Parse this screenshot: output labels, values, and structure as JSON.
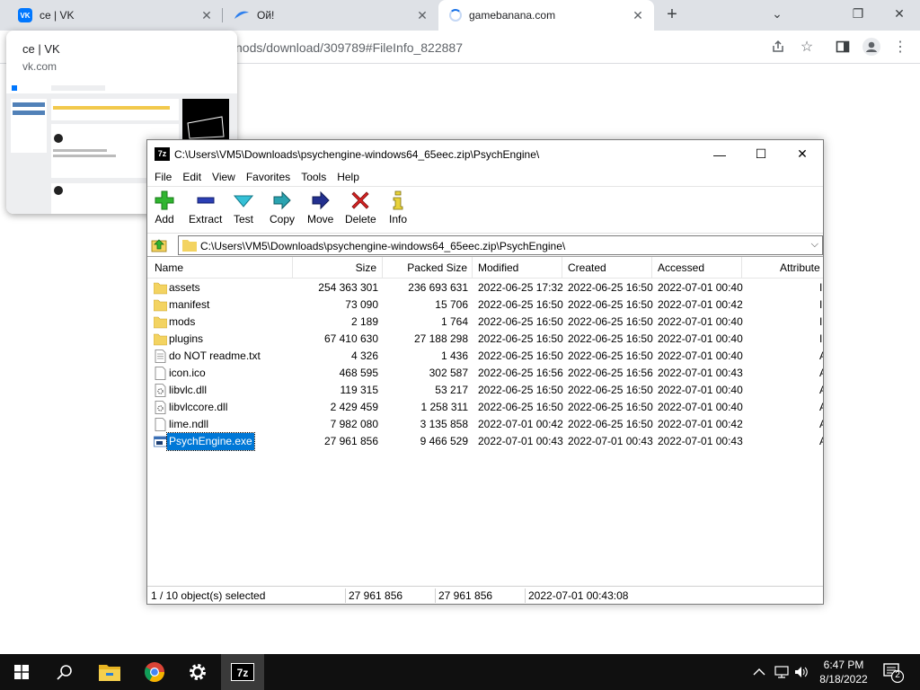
{
  "browser": {
    "tabs": [
      {
        "title": "ce | VK",
        "favicon": "vk-icon"
      },
      {
        "title": "Ой!",
        "favicon": "oy-icon"
      },
      {
        "title": "gamebanana.com",
        "favicon": "loading-spinner-icon"
      }
    ],
    "address": "nods/download/309789#FileInfo_822887",
    "hovercard": {
      "title": "ce | VK",
      "url": "vk.com"
    }
  },
  "zip": {
    "title": "C:\\Users\\VM5\\Downloads\\psychengine-windows64_65eec.zip\\PsychEngine\\",
    "logo": "7z",
    "menu": [
      "File",
      "Edit",
      "View",
      "Favorites",
      "Tools",
      "Help"
    ],
    "toolbar": [
      "Add",
      "Extract",
      "Test",
      "Copy",
      "Move",
      "Delete",
      "Info"
    ],
    "address": "C:\\Users\\VM5\\Downloads\\psychengine-windows64_65eec.zip\\PsychEngine\\",
    "columns": [
      "Name",
      "Size",
      "Packed Size",
      "Modified",
      "Created",
      "Accessed",
      "Attribute"
    ],
    "files": [
      {
        "name": "assets",
        "type": "folder",
        "size": "254 363 301",
        "packed": "236 693 631",
        "modified": "2022-06-25 17:32",
        "created": "2022-06-25 16:50",
        "accessed": "2022-07-01 00:40",
        "attr": "I"
      },
      {
        "name": "manifest",
        "type": "folder",
        "size": "73 090",
        "packed": "15 706",
        "modified": "2022-06-25 16:50",
        "created": "2022-06-25 16:50",
        "accessed": "2022-07-01 00:42",
        "attr": "I"
      },
      {
        "name": "mods",
        "type": "folder",
        "size": "2 189",
        "packed": "1 764",
        "modified": "2022-06-25 16:50",
        "created": "2022-06-25 16:50",
        "accessed": "2022-07-01 00:40",
        "attr": "I"
      },
      {
        "name": "plugins",
        "type": "folder",
        "size": "67 410 630",
        "packed": "27 188 298",
        "modified": "2022-06-25 16:50",
        "created": "2022-06-25 16:50",
        "accessed": "2022-07-01 00:40",
        "attr": "I"
      },
      {
        "name": "do NOT readme.txt",
        "type": "text",
        "size": "4 326",
        "packed": "1 436",
        "modified": "2022-06-25 16:50",
        "created": "2022-06-25 16:50",
        "accessed": "2022-07-01 00:40",
        "attr": "A"
      },
      {
        "name": "icon.ico",
        "type": "file",
        "size": "468 595",
        "packed": "302 587",
        "modified": "2022-06-25 16:56",
        "created": "2022-06-25 16:56",
        "accessed": "2022-07-01 00:43",
        "attr": "A"
      },
      {
        "name": "libvlc.dll",
        "type": "dll",
        "size": "119 315",
        "packed": "53 217",
        "modified": "2022-06-25 16:50",
        "created": "2022-06-25 16:50",
        "accessed": "2022-07-01 00:40",
        "attr": "A"
      },
      {
        "name": "libvlccore.dll",
        "type": "dll",
        "size": "2 429 459",
        "packed": "1 258 311",
        "modified": "2022-06-25 16:50",
        "created": "2022-06-25 16:50",
        "accessed": "2022-07-01 00:40",
        "attr": "A"
      },
      {
        "name": "lime.ndll",
        "type": "file",
        "size": "7 982 080",
        "packed": "3 135 858",
        "modified": "2022-07-01 00:42",
        "created": "2022-06-25 16:50",
        "accessed": "2022-07-01 00:42",
        "attr": "A"
      },
      {
        "name": "PsychEngine.exe",
        "type": "exe",
        "size": "27 961 856",
        "packed": "9 466 529",
        "modified": "2022-07-01 00:43",
        "created": "2022-07-01 00:43",
        "accessed": "2022-07-01 00:43",
        "attr": "A",
        "selected": true
      }
    ],
    "status": {
      "selection": "1 / 10 object(s) selected",
      "size": "27 961 856",
      "packed": "27 961 856",
      "modified": "2022-07-01 00:43:08"
    }
  },
  "taskbar": {
    "apps": [
      "start-icon",
      "search-icon",
      "file-explorer-icon",
      "chrome-icon",
      "settings-icon",
      "7zip-icon"
    ],
    "time": "6:47 PM",
    "date": "8/18/2022",
    "notifications": "2"
  }
}
